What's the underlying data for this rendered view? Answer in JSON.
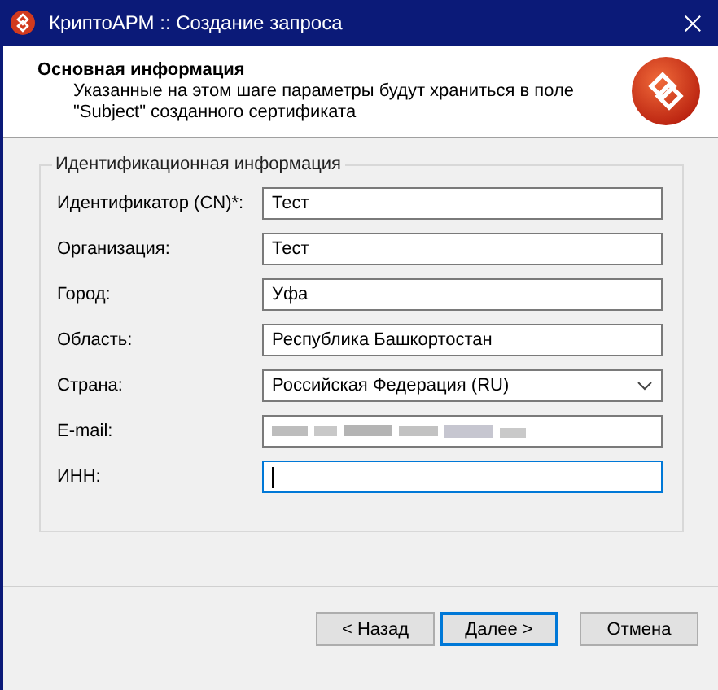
{
  "window": {
    "title": "КриптоАРМ :: Создание запроса"
  },
  "header": {
    "title": "Основная информация",
    "description": "Указанные на этом шаге параметры будут храниться в поле \"Subject\" созданного сертификата"
  },
  "group": {
    "title": "Идентификационная информация",
    "fields": [
      {
        "label": "Идентификатор (CN)*:",
        "kind": "text",
        "value": "Тест",
        "focused": false
      },
      {
        "label": "Организация:",
        "kind": "text",
        "value": "Тест",
        "focused": false
      },
      {
        "label": "Город:",
        "kind": "text",
        "value": "Уфа",
        "focused": false
      },
      {
        "label": "Область:",
        "kind": "text",
        "value": "Республика Башкортостан",
        "focused": false
      },
      {
        "label": "Страна:",
        "kind": "select",
        "value": "Российская Федерация (RU)",
        "focused": false
      },
      {
        "label": "E-mail:",
        "kind": "redacted",
        "focused": false
      },
      {
        "label": "ИНН:",
        "kind": "text",
        "focused": true
      }
    ]
  },
  "buttons": [
    {
      "label": "< Назад",
      "default": false
    },
    {
      "label": "Далее >",
      "default": true
    },
    {
      "label": "Отмена",
      "default": false
    }
  ]
}
